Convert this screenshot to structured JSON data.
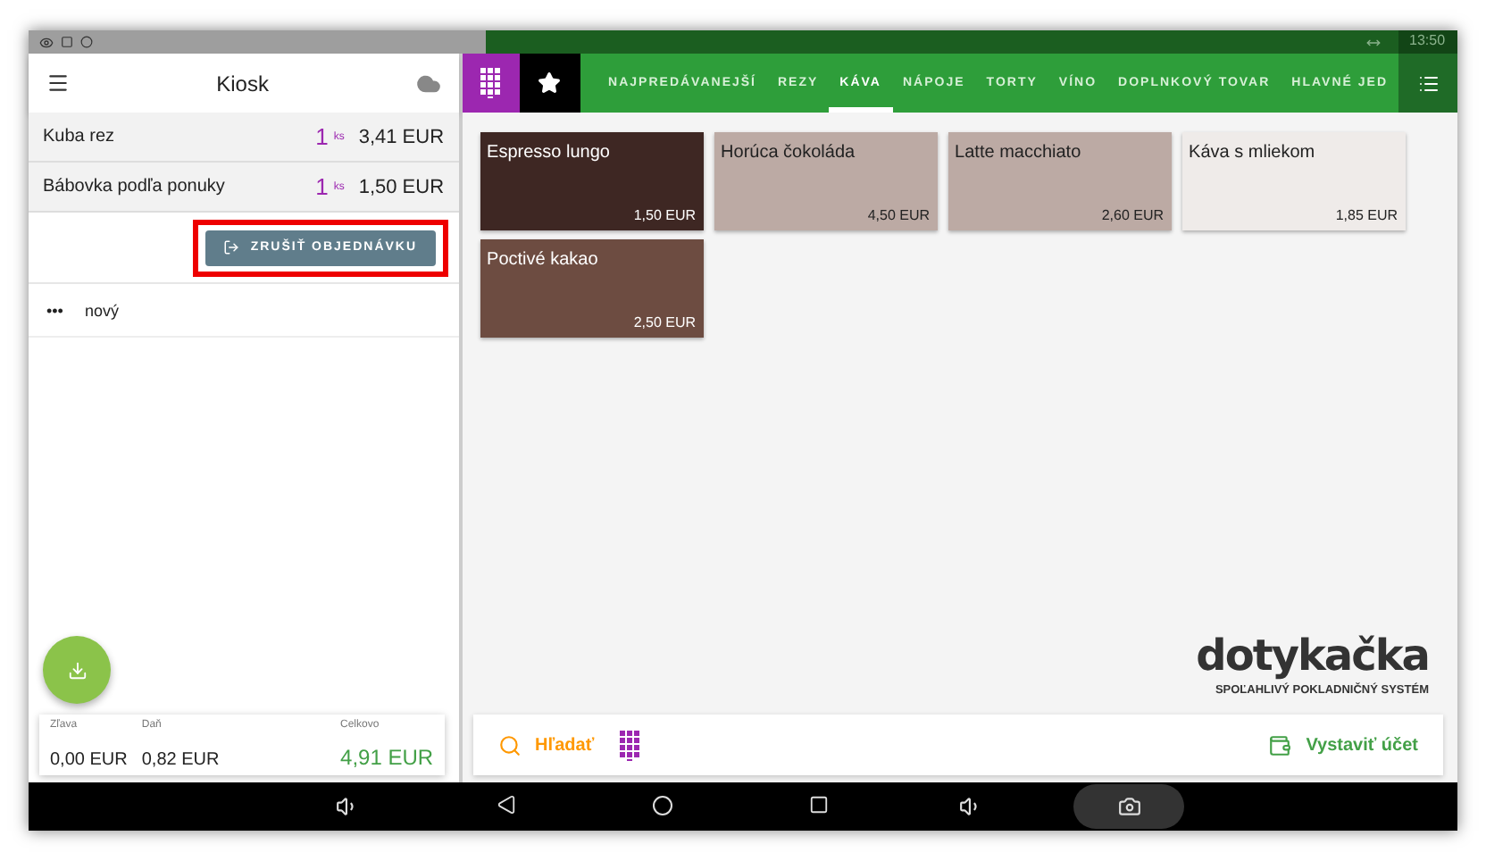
{
  "status_bar": {
    "time": "13:50"
  },
  "order_panel": {
    "title": "Kiosk",
    "items": [
      {
        "name": "Kuba rez",
        "quantity": "1",
        "unit": "ks",
        "price": "3,41 EUR"
      },
      {
        "name": "Bábovka podľa ponuky",
        "quantity": "1",
        "unit": "ks",
        "price": "1,50 EUR"
      }
    ],
    "cancel_button": {
      "label": "ZRUŠIŤ OBJEDNÁVKU",
      "highlighted": true
    },
    "pending_orders": [
      {
        "menu": "•••",
        "name": "nový"
      }
    ],
    "summary": [
      {
        "label": "Zľava",
        "value": "0,00 EUR",
        "kind": "plain"
      },
      {
        "label": "Daň",
        "value": "0,82 EUR",
        "kind": "plain"
      },
      {
        "label": "Celkovo",
        "value": "4,91 EUR",
        "kind": "total"
      }
    ]
  },
  "tabs": [
    {
      "label": "NAJPREDÁVANEJŠÍ",
      "selected": false
    },
    {
      "label": "REZY",
      "selected": false
    },
    {
      "label": "KÁVA",
      "selected": true
    },
    {
      "label": "NÁPOJE",
      "selected": false
    },
    {
      "label": "TORTY",
      "selected": false
    },
    {
      "label": "VÍNO",
      "selected": false
    },
    {
      "label": "DOPLNKOVÝ TOVAR",
      "selected": false
    },
    {
      "label": "HLAVNÉ JED",
      "selected": false
    }
  ],
  "products": [
    {
      "name": "Espresso lungo",
      "price": "1,50 EUR",
      "color": "#3e2723"
    },
    {
      "name": "Horúca čokoláda",
      "price": "4,50 EUR",
      "color": "#bcaaa4"
    },
    {
      "name": "Latte macchiato",
      "price": "2,60 EUR",
      "color": "#bcaaa4"
    },
    {
      "name": "Káva s mliekom",
      "price": "1,85 EUR",
      "color": "#efebe9"
    },
    {
      "name": "Poctivé kakao",
      "price": "2,50 EUR",
      "color": "#6d4c41"
    }
  ],
  "logo": {
    "wordmark": "dotykačka",
    "tagline": "SPOĽAHLIVÝ POKLADNIČNÝ SYSTÉM"
  },
  "bottom_bar": {
    "search": "Hľadať",
    "checkout": "Vystaviť účet"
  }
}
